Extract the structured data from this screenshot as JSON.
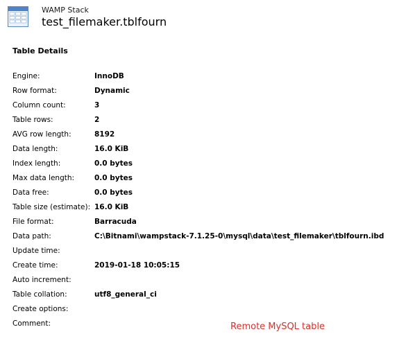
{
  "header": {
    "icon": "table-icon",
    "subtitle": "WAMP Stack",
    "title": "test_filemaker.tblfourn"
  },
  "section": {
    "heading": "Table Details"
  },
  "details": [
    {
      "label": "Engine:",
      "value": "InnoDB"
    },
    {
      "label": "Row format:",
      "value": "Dynamic"
    },
    {
      "label": "Column count:",
      "value": "3"
    },
    {
      "label": "Table rows:",
      "value": "2"
    },
    {
      "label": "AVG row length:",
      "value": "8192"
    },
    {
      "label": "Data length:",
      "value": "16.0 KiB"
    },
    {
      "label": "Index length:",
      "value": "0.0 bytes"
    },
    {
      "label": "Max data length:",
      "value": "0.0 bytes"
    },
    {
      "label": "Data free:",
      "value": "0.0 bytes"
    },
    {
      "label": "Table size (estimate):",
      "value": "16.0 KiB"
    },
    {
      "label": "File format:",
      "value": "Barracuda"
    },
    {
      "label": "Data path:",
      "value": "C:\\Bitnami\\wampstack-7.1.25-0\\mysql\\data\\test_filemaker\\tblfourn.ibd"
    },
    {
      "label": "Update time:",
      "value": ""
    },
    {
      "label": "Create time:",
      "value": "2019-01-18 10:05:15"
    },
    {
      "label": "Auto increment:",
      "value": ""
    },
    {
      "label": "Table collation:",
      "value": "utf8_general_ci"
    },
    {
      "label": "Create options:",
      "value": ""
    },
    {
      "label": "Comment:",
      "value": ""
    }
  ],
  "annotation": {
    "text": "Remote MySQL table",
    "color": "#d8302a"
  }
}
